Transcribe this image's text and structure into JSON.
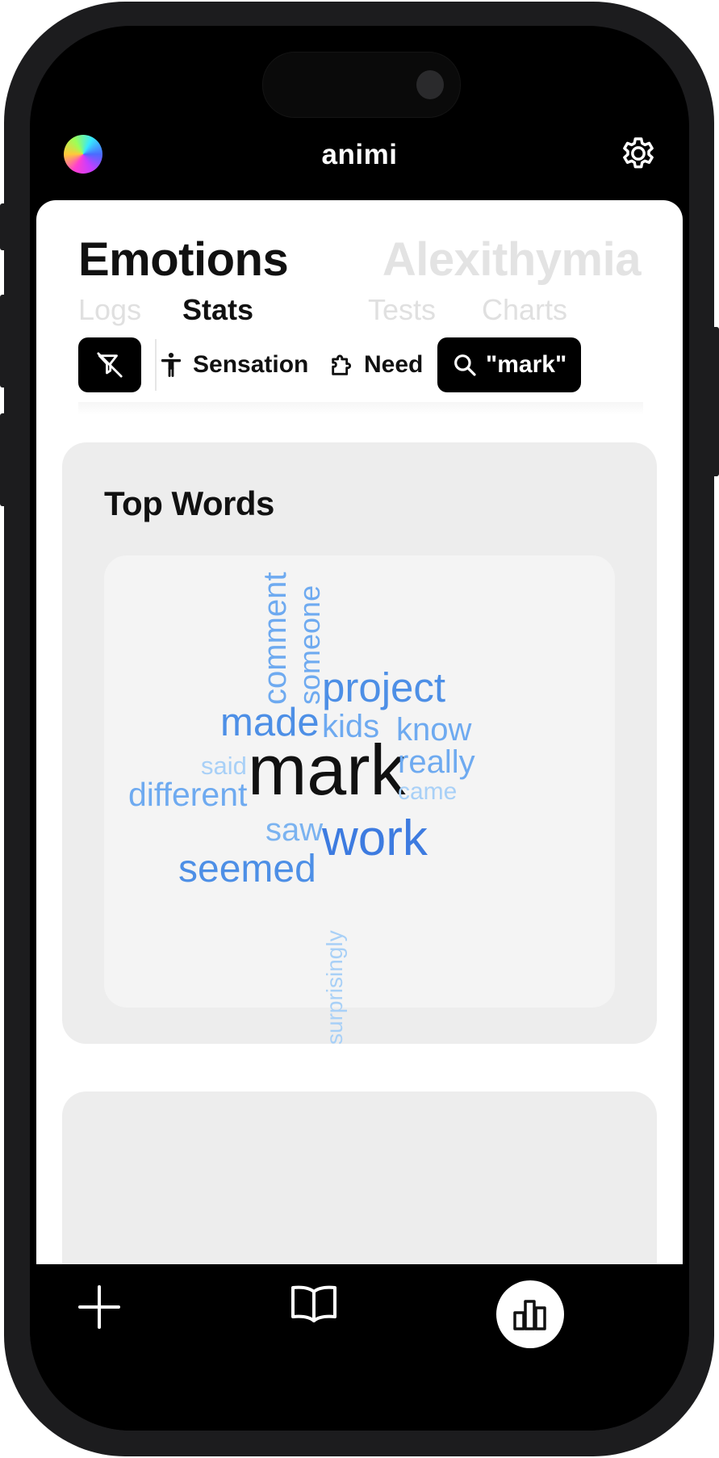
{
  "header": {
    "app_title": "animi",
    "logo_icon": "gradient-orb-icon",
    "settings_icon": "gear-icon"
  },
  "page": {
    "title": "Emotions",
    "alt_title": "Alexithymia",
    "subtabs": {
      "logs": "Logs",
      "stats": "Stats",
      "tests": "Tests",
      "charts": "Charts"
    },
    "active_subtab": "Stats"
  },
  "filters": {
    "toggle_icon": "filter-off-icon",
    "sensation": "Sensation",
    "need": "Need",
    "search": "\"mark\""
  },
  "top_words": {
    "title": "Top Words",
    "words": [
      {
        "text": "mark",
        "color": "#111111",
        "orientation": "horizontal"
      },
      {
        "text": "work",
        "color": "#3d7be0",
        "orientation": "horizontal"
      },
      {
        "text": "project",
        "color": "#4d8fe6",
        "orientation": "horizontal"
      },
      {
        "text": "made",
        "color": "#4d8fe6",
        "orientation": "horizontal"
      },
      {
        "text": "seemed",
        "color": "#4d8fe6",
        "orientation": "horizontal"
      },
      {
        "text": "different",
        "color": "#6eaaf0",
        "orientation": "horizontal"
      },
      {
        "text": "kids",
        "color": "#6eaaf0",
        "orientation": "horizontal"
      },
      {
        "text": "know",
        "color": "#6eaaf0",
        "orientation": "horizontal"
      },
      {
        "text": "really",
        "color": "#6eaaf0",
        "orientation": "horizontal"
      },
      {
        "text": "saw",
        "color": "#7bb3f0",
        "orientation": "horizontal"
      },
      {
        "text": "came",
        "color": "#a8d0f7",
        "orientation": "horizontal"
      },
      {
        "text": "said",
        "color": "#a8d0f7",
        "orientation": "horizontal"
      },
      {
        "text": "comment",
        "color": "#6eaaf0",
        "orientation": "vertical"
      },
      {
        "text": "someone",
        "color": "#6eaaf0",
        "orientation": "vertical"
      },
      {
        "text": "surprisingly",
        "color": "#a8d0f7",
        "orientation": "vertical"
      }
    ]
  },
  "tabbar": {
    "add_icon": "plus-icon",
    "journal_icon": "book-icon",
    "stats_icon": "bar-chart-icon",
    "active": "stats"
  }
}
